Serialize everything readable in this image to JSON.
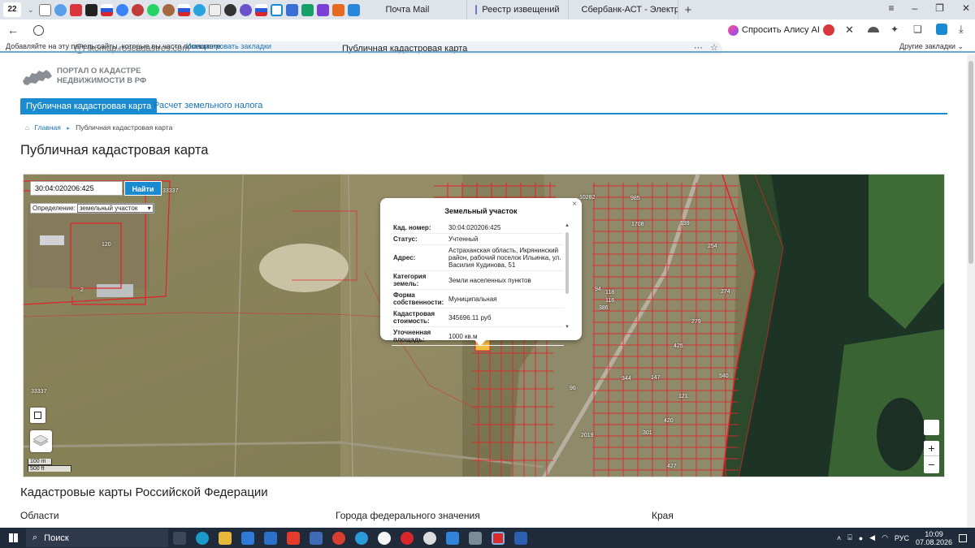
{
  "browser": {
    "tab_count": "22",
    "tabs": [
      {
        "label": "Почта Mail",
        "color": "#3b82f6"
      },
      {
        "label": "Реестр извещений",
        "color": "#6b7cd6"
      },
      {
        "label": "Сбербанк-АСТ - Электро",
        "color": "#2e9e5b"
      }
    ],
    "url": "lk6map.roscadastres.com",
    "page_title": "Публичная кадастровая карта",
    "alice_label": "Спросить Алису AI",
    "bookmarks_hint": "Добавляйте на эту панель сайты, которые вы часто посещаете.",
    "bookmarks_import": "Импортировать закладки",
    "other_bookmarks": "Другие закладки"
  },
  "site": {
    "logo_line1": "ПОРТАЛ О КАДАСТРЕ",
    "logo_line2": "НЕДВИЖИМОСТИ В РФ",
    "nav": [
      "Публичная кадастровая карта",
      "Расчет земельного налога"
    ],
    "breadcrumb_home": "Главная",
    "breadcrumb_current": "Публичная кадастровая карта",
    "heading": "Публичная кадастровая карта",
    "section_heading": "Кадастровые карты Российской Федерации",
    "columns": [
      "Области",
      "Города федерального значения",
      "Края"
    ]
  },
  "map": {
    "search_value": "30:04:020206:425",
    "search_button": "Найти",
    "definition_label": "Определение:",
    "definition_value": "земельный участок",
    "scale_m": "100 m",
    "scale_ft": "500 ft",
    "zoom_in": "+",
    "zoom_out": "−",
    "parcel_labels": [
      "33337",
      "120",
      "2",
      "33337",
      "985",
      "10282",
      "139",
      "254",
      "274",
      "118",
      "116",
      "386",
      "94",
      "425",
      "279",
      "344",
      "147",
      "540",
      "121",
      "420",
      "96",
      "301",
      "2019",
      "1708",
      "427"
    ]
  },
  "popup": {
    "title": "Земельный участок",
    "rows": [
      {
        "key": "Кад. номер:",
        "value": "30:04:020206:425"
      },
      {
        "key": "Статус:",
        "value": "Учтенный"
      },
      {
        "key": "Адрес:",
        "value": "Астраханская область, Икрянинский район, рабочий поселок Ильинка, ул. Василия Кудинова, 51"
      },
      {
        "key": "Категория земель:",
        "value": "Земли населенных пунктов"
      },
      {
        "key": "Форма собственности:",
        "value": "Муниципальная"
      },
      {
        "key": "Кадастровая стоимость:",
        "value": "345696.11 руб"
      },
      {
        "key": "Уточненная площадь:",
        "value": "1000 кв.м"
      }
    ]
  },
  "taskbar": {
    "search_label": "Поиск",
    "lang": "РУС",
    "time": "10:09",
    "date": "07.08.2026"
  },
  "colors": {
    "accent": "#1a8bd1",
    "link": "#1a73b5",
    "parcel_line": "#e0242b"
  }
}
